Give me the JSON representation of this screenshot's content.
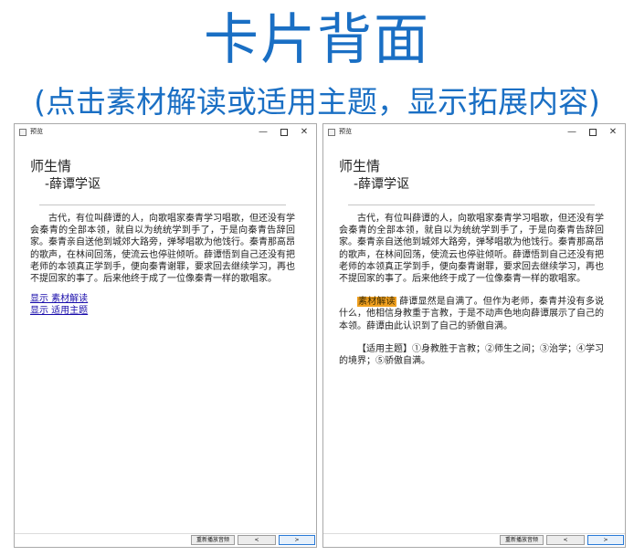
{
  "headline": "卡片背面",
  "subheadline": "(点击素材解读或适用主题，显示拓展内容)",
  "window": {
    "title": "预览",
    "minimize": "—",
    "close": "✕",
    "card_title": "师生情",
    "card_author": "-薛谭学讴",
    "body": "古代，有位叫薛谭的人，向歌唱家秦青学习唱歌，但还没有学会秦青的全部本领，就自以为统统学到手了，于是向秦青告辞回家。秦青亲自送他到城郊大路旁，弹琴唱歌为他饯行。秦青那高昂的歌声，在林间回荡，使流云也停驻倾听。薛谭悟到自己还没有把老师的本领真正学到手，便向秦青谢罪，要求回去继续学习，再也不提回家的事了。后来他终于成了一位像秦青一样的歌唱家。",
    "link_interpretation": "显示 素材解读",
    "link_theme": "显示 适用主题",
    "interpretation_label": "素材解读",
    "interpretation_text": "薛谭显然是自满了。但作为老师，秦青并没有多说什么，他相信身教重于言教，于是不动声色地向薛谭展示了自己的本领。薛谭由此认识到了自己的骄傲自满。",
    "theme_text": "【适用主题】①身教胜于言教；②师生之间；③治学；④学习的境界；⑤骄傲自满。",
    "btn_replay": "重新播放音频",
    "btn_prev": "<",
    "btn_next": ">"
  },
  "colors": {
    "headline": "#1a6fc4",
    "highlight": "#f0a020",
    "link": "#1a0dab"
  }
}
